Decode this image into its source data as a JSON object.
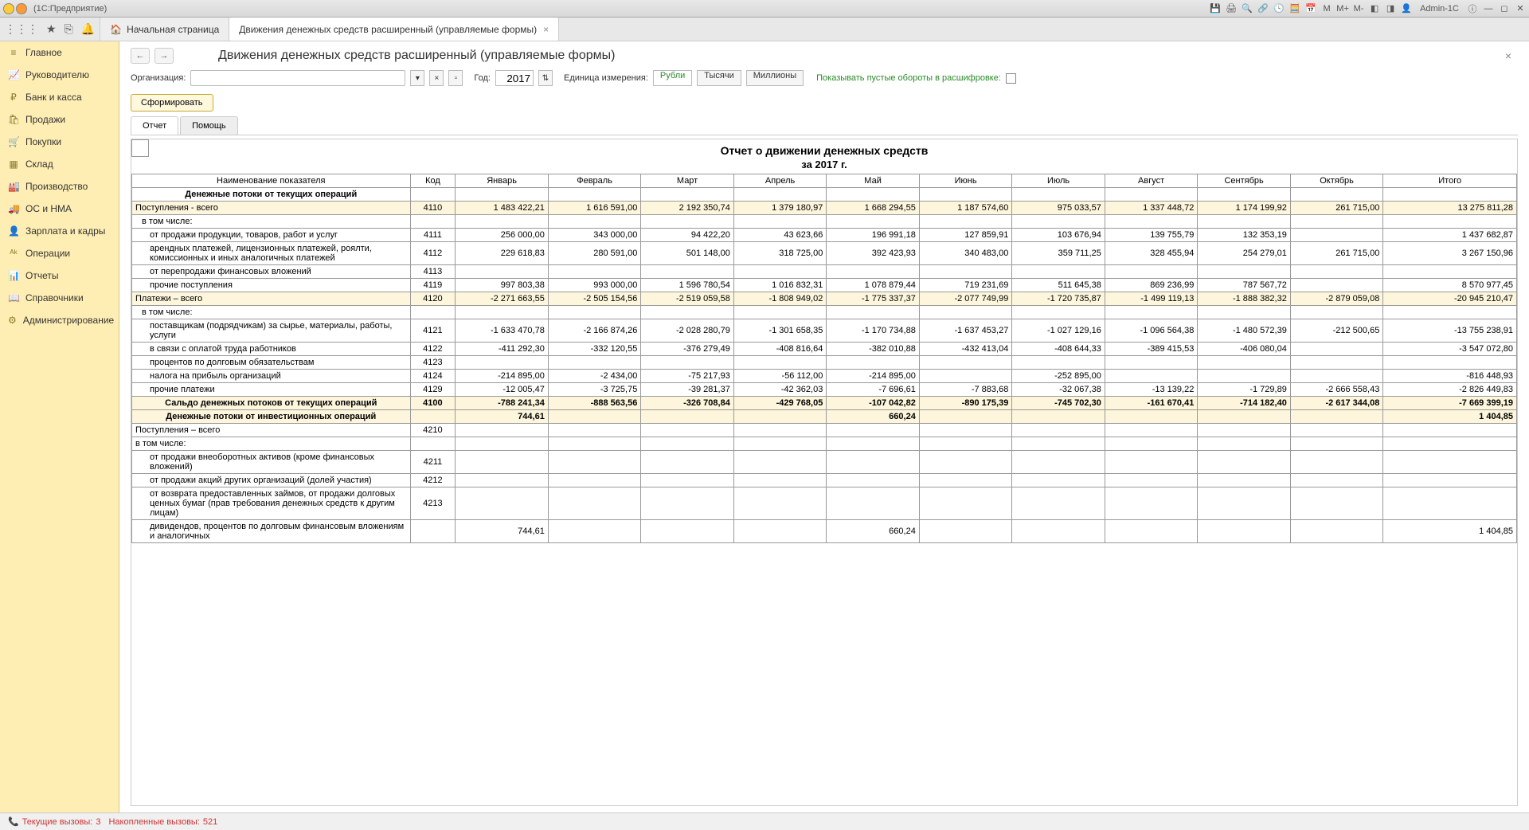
{
  "titlebar": {
    "text": "(1С:Предприятие)",
    "user": "Admin-1C"
  },
  "tabs": {
    "home": "Начальная страница",
    "active": "Движения денежных средств расширенный (управляемые формы)"
  },
  "sidebar": [
    {
      "icon": "≡",
      "label": "Главное"
    },
    {
      "icon": "📈",
      "label": "Руководителю"
    },
    {
      "icon": "₽",
      "label": "Банк и касса"
    },
    {
      "icon": "🛍",
      "label": "Продажи"
    },
    {
      "icon": "🛒",
      "label": "Покупки"
    },
    {
      "icon": "▦",
      "label": "Склад"
    },
    {
      "icon": "🏭",
      "label": "Производство"
    },
    {
      "icon": "🚚",
      "label": "ОС и НМА"
    },
    {
      "icon": "👤",
      "label": "Зарплата и кадры"
    },
    {
      "icon": "ᴬᵏ",
      "label": "Операции"
    },
    {
      "icon": "📊",
      "label": "Отчеты"
    },
    {
      "icon": "📖",
      "label": "Справочники"
    },
    {
      "icon": "⚙",
      "label": "Администрирование"
    }
  ],
  "page": {
    "title": "Движения денежных средств расширенный (управляемые формы)",
    "org_label": "Организация:",
    "year_label": "Год:",
    "year": "2017",
    "unit_label": "Единица измерения:",
    "units": [
      "Рубли",
      "Тысячи",
      "Миллионы"
    ],
    "empty_label": "Показывать пустые обороты в расшифровке:",
    "form_btn": "Сформировать",
    "subtabs": [
      "Отчет",
      "Помощь"
    ]
  },
  "report": {
    "title": "Отчет о движении денежных средств",
    "subtitle": "за 2017 г.",
    "headers": [
      "Наименование показателя",
      "Код",
      "Январь",
      "Февраль",
      "Март",
      "Апрель",
      "Май",
      "Июнь",
      "Июль",
      "Август",
      "Сентябрь",
      "Октябрь",
      "Итого"
    ],
    "rows": [
      {
        "name": "Денежные потоки от текущих операций",
        "bold": true
      },
      {
        "name": "Поступления - всего",
        "code": "4110",
        "vals": [
          "1 483 422,21",
          "1 616 591,00",
          "2 192 350,74",
          "1 379 180,97",
          "1 668 294,55",
          "1 187 574,60",
          "975 033,57",
          "1 337 448,72",
          "1 174 199,92",
          "261 715,00",
          "13 275 811,28"
        ],
        "hl": true
      },
      {
        "name": "в том числе:",
        "indent": 1
      },
      {
        "name": "от продажи продукции, товаров, работ и услуг",
        "code": "4111",
        "indent": 2,
        "vals": [
          "256 000,00",
          "343 000,00",
          "94 422,20",
          "43 623,66",
          "196 991,18",
          "127 859,91",
          "103 676,94",
          "139 755,79",
          "132 353,19",
          "",
          "1 437 682,87"
        ]
      },
      {
        "name": "арендных платежей, лицензионных платежей, роялти, комиссионных и иных аналогичных платежей",
        "code": "4112",
        "indent": 2,
        "vals": [
          "229 618,83",
          "280 591,00",
          "501 148,00",
          "318 725,00",
          "392 423,93",
          "340 483,00",
          "359 711,25",
          "328 455,94",
          "254 279,01",
          "261 715,00",
          "3 267 150,96"
        ]
      },
      {
        "name": "от перепродажи финансовых вложений",
        "code": "4113",
        "indent": 2
      },
      {
        "name": "прочие поступления",
        "code": "4119",
        "indent": 2,
        "vals": [
          "997 803,38",
          "993 000,00",
          "1 596 780,54",
          "1 016 832,31",
          "1 078 879,44",
          "719 231,69",
          "511 645,38",
          "869 236,99",
          "787 567,72",
          "",
          "8 570 977,45"
        ]
      },
      {
        "name": "Платежи – всего",
        "code": "4120",
        "vals": [
          "-2 271 663,55",
          "-2 505 154,56",
          "-2 519 059,58",
          "-1 808 949,02",
          "-1 775 337,37",
          "-2 077 749,99",
          "-1 720 735,87",
          "-1 499 119,13",
          "-1 888 382,32",
          "-2 879 059,08",
          "-20 945 210,47"
        ],
        "hl": true
      },
      {
        "name": "в том числе:",
        "indent": 1
      },
      {
        "name": "поставщикам (подрядчикам) за сырье, материалы, работы, услуги",
        "code": "4121",
        "indent": 2,
        "vals": [
          "-1 633 470,78",
          "-2 166 874,26",
          "-2 028 280,79",
          "-1 301 658,35",
          "-1 170 734,88",
          "-1 637 453,27",
          "-1 027 129,16",
          "-1 096 564,38",
          "-1 480 572,39",
          "-212 500,65",
          "-13 755 238,91"
        ]
      },
      {
        "name": "в связи с оплатой труда работников",
        "code": "4122",
        "indent": 2,
        "vals": [
          "-411 292,30",
          "-332 120,55",
          "-376 279,49",
          "-408 816,64",
          "-382 010,88",
          "-432 413,04",
          "-408 644,33",
          "-389 415,53",
          "-406 080,04",
          "",
          "-3 547 072,80"
        ]
      },
      {
        "name": "процентов по долговым обязательствам",
        "code": "4123",
        "indent": 2
      },
      {
        "name": "налога на прибыль организаций",
        "code": "4124",
        "indent": 2,
        "vals": [
          "-214 895,00",
          "-2 434,00",
          "-75 217,93",
          "-56 112,00",
          "-214 895,00",
          "",
          "-252 895,00",
          "",
          "",
          "",
          "-816 448,93"
        ]
      },
      {
        "name": "прочие платежи",
        "code": "4129",
        "indent": 2,
        "vals": [
          "-12 005,47",
          "-3 725,75",
          "-39 281,37",
          "-42 362,03",
          "-7 696,61",
          "-7 883,68",
          "-32 067,38",
          "-13 139,22",
          "-1 729,89",
          "-2 666 558,43",
          "-2 826 449,83"
        ]
      },
      {
        "name": "Сальдо денежных потоков от текущих операций",
        "code": "4100",
        "bold": true,
        "hl": true,
        "vals": [
          "-788 241,34",
          "-888 563,56",
          "-326 708,84",
          "-429 768,05",
          "-107 042,82",
          "-890 175,39",
          "-745 702,30",
          "-161 670,41",
          "-714 182,40",
          "-2 617 344,08",
          "-7 669 399,19"
        ]
      },
      {
        "name": "Денежные потоки от инвестиционных операций",
        "bold": true,
        "hl": true,
        "vals": [
          "744,61",
          "",
          "",
          "",
          "660,24",
          "",
          "",
          "",
          "",
          "",
          "1 404,85"
        ]
      },
      {
        "name": "Поступления – всего",
        "code": "4210"
      },
      {
        "name": "в том числе:",
        "indent": 0
      },
      {
        "name": "от продажи внеоборотных активов (кроме финансовых вложений)",
        "code": "4211",
        "indent": 2
      },
      {
        "name": "от продажи акций других организаций (долей участия)",
        "code": "4212",
        "indent": 2
      },
      {
        "name": "от возврата предоставленных займов, от продажи долговых ценных бумаг (прав требования денежных средств к другим лицам)",
        "code": "4213",
        "indent": 2
      },
      {
        "name": "дивидендов, процентов по долговым финансовым вложениям и аналогичных",
        "indent": 2,
        "vals": [
          "744,61",
          "",
          "",
          "",
          "660,24",
          "",
          "",
          "",
          "",
          "",
          "1 404,85"
        ]
      }
    ]
  },
  "status": {
    "s1_l": "Текущие вызовы:",
    "s1_v": "3",
    "s2_l": "Накопленные вызовы:",
    "s2_v": "521"
  }
}
